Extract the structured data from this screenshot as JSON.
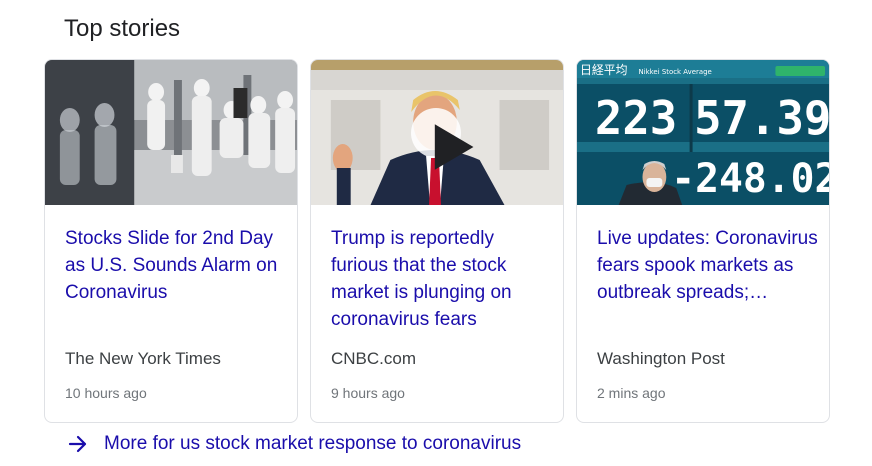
{
  "section": {
    "title": "Top stories"
  },
  "cards": [
    {
      "headline": "Stocks Slide for 2nd Day as U.S. Sounds Alarm on Coronavirus",
      "source": "The New York Times",
      "time": "10 hours ago",
      "image": "workers-in-hazmat-suits"
    },
    {
      "headline": "Trump is reportedly furious that the stock market is plunging on coronavirus fears",
      "source": "CNBC.com",
      "time": "9 hours ago",
      "image": "trump-speaking-video",
      "has_video": true
    },
    {
      "headline": "Live updates: Coronavirus fears spook markets as outbreak spreads;…",
      "source": "Washington Post",
      "time": "2 mins ago",
      "image": "nikkei-stock-board",
      "board": {
        "label_jp": "日経平均",
        "label_en": "Nikkei Stock Average",
        "index_value": "22357.39",
        "index_part1": "223",
        "index_part2": "57.39",
        "change": "-248.02"
      }
    }
  ],
  "more_link": {
    "label": "More for us stock market response to coronavirus",
    "icon": "arrow-right-icon"
  },
  "colors": {
    "link": "#1a0dab",
    "source": "#3c4043",
    "time": "#70757a",
    "border": "#dfe1e5"
  }
}
